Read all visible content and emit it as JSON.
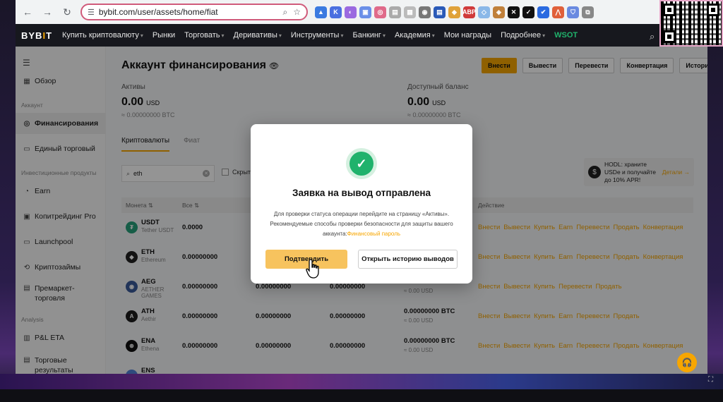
{
  "browser": {
    "url": "bybit.com/user/assets/home/fiat"
  },
  "header": {
    "logo_main": "BYB",
    "logo_accent": "I",
    "logo_end": "T",
    "menu": [
      {
        "label": "Купить криптовалюту",
        "chevron": true
      },
      {
        "label": "Рынки",
        "chevron": false
      },
      {
        "label": "Торговать",
        "chevron": true
      },
      {
        "label": "Деривативы",
        "chevron": true
      },
      {
        "label": "Инструменты",
        "chevron": true
      },
      {
        "label": "Банкинг",
        "chevron": true
      },
      {
        "label": "Академия",
        "chevron": true
      },
      {
        "label": "Мои награды",
        "chevron": false
      },
      {
        "label": "Подробнее",
        "chevron": true
      },
      {
        "label": "WSOT",
        "chevron": false
      }
    ]
  },
  "sidebar": {
    "overview": "Обзор",
    "section_account": "Аккаунт",
    "funding": "Финансирования",
    "unified": "Единый торговый",
    "section_invest": "Инвестиционные продукты",
    "earn": "Earn",
    "copy": "Копитрейдинг Pro",
    "launchpool": "Launchpool",
    "loans": "Криптозаймы",
    "premarket_1": "Премаркет-",
    "premarket_2": "торговля",
    "section_analysis": "Analysis",
    "pnl": "P&L ETA",
    "trade_results_1": "Торговые",
    "trade_results_2": "результаты"
  },
  "main": {
    "title": "Аккаунт финансирования",
    "actions": [
      "Внести",
      "Вывести",
      "Перевести",
      "Конвертация",
      "История"
    ],
    "assets_label": "Активы",
    "assets_value": "0.00",
    "assets_currency": "USD",
    "assets_btc": "≈ 0.00000000 BTC",
    "available_label": "Доступный баланс",
    "available_value": "0.00",
    "available_currency": "USD",
    "available_btc": "≈ 0.00000000 BTC",
    "tabs": [
      "Криптовалюты",
      "Фиат"
    ],
    "search_value": "eth",
    "hide_label": "Скрыт",
    "promo_text": "HODL: храните USDe и получайте до 10% APR!",
    "promo_more": "Детали →",
    "table_headers": {
      "coin": "Монета ⇅",
      "all": "Все ⇅",
      "action": "Действие"
    },
    "rows": [
      {
        "sym": "USDT",
        "name": "Tether USDT",
        "all": "0.0000",
        "col2": "",
        "col3": "",
        "btc": "",
        "usd": "",
        "ops": [
          "Внести",
          "Вывести",
          "Купить",
          "Earn",
          "Перевести",
          "Продать",
          "Конвертация"
        ],
        "color": "#26a17b",
        "glyph": "₮"
      },
      {
        "sym": "ETH",
        "name": "Ethereum",
        "all": "0.00000000",
        "col2": "",
        "col3": "",
        "btc": "",
        "usd": "",
        "ops": [
          "Внести",
          "Вывести",
          "Купить",
          "Earn",
          "Перевести",
          "Продать",
          "Конвертация"
        ],
        "color": "#222222",
        "glyph": "◆"
      },
      {
        "sym": "AEG",
        "name": "AETHER GAMES",
        "all": "0.00000000",
        "col2": "0.00000000",
        "col3": "0.00000000",
        "btc": "0.00000000 BTC",
        "usd": "≈ 0.00 USD",
        "ops": [
          "Внести",
          "Вывести",
          "Купить",
          "Перевести",
          "Продать"
        ],
        "color": "#3a5a9a",
        "glyph": "◉"
      },
      {
        "sym": "ATH",
        "name": "Aethir",
        "all": "0.00000000",
        "col2": "0.00000000",
        "col3": "0.00000000",
        "btc": "0.00000000 BTC",
        "usd": "≈ 0.00 USD",
        "ops": [
          "Внести",
          "Вывести",
          "Купить",
          "Earn",
          "Перевести",
          "Продать"
        ],
        "color": "#1c1c1c",
        "glyph": "A"
      },
      {
        "sym": "ENA",
        "name": "Ethena",
        "all": "0.00000000",
        "col2": "0.00000000",
        "col3": "0.00000000",
        "btc": "0.00000000 BTC",
        "usd": "≈ 0.00 USD",
        "ops": [
          "Внести",
          "Вывести",
          "Купить",
          "Earn",
          "Перевести",
          "Продать",
          "Конвертация"
        ],
        "color": "#111111",
        "glyph": "⊛"
      },
      {
        "sym": "ENS",
        "name": "",
        "all": "",
        "col2": "",
        "col3": "",
        "btc": "",
        "usd": "",
        "ops": [],
        "color": "#5282d8",
        "glyph": ""
      }
    ]
  },
  "modal": {
    "title": "Заявка на вывод отправлена",
    "desc_1": "Для проверки статуса операции перейдите на страницу «Активы».",
    "desc_2": "Рекомендуемые способы проверки безопасности для защиты вашего",
    "desc_3": "аккаунта:",
    "desc_link": "Финансовый пароль",
    "confirm": "Подтвердить",
    "history": "Открыть историю выводов"
  },
  "colors": {
    "accent": "#f7a600",
    "success": "#20b26c"
  }
}
